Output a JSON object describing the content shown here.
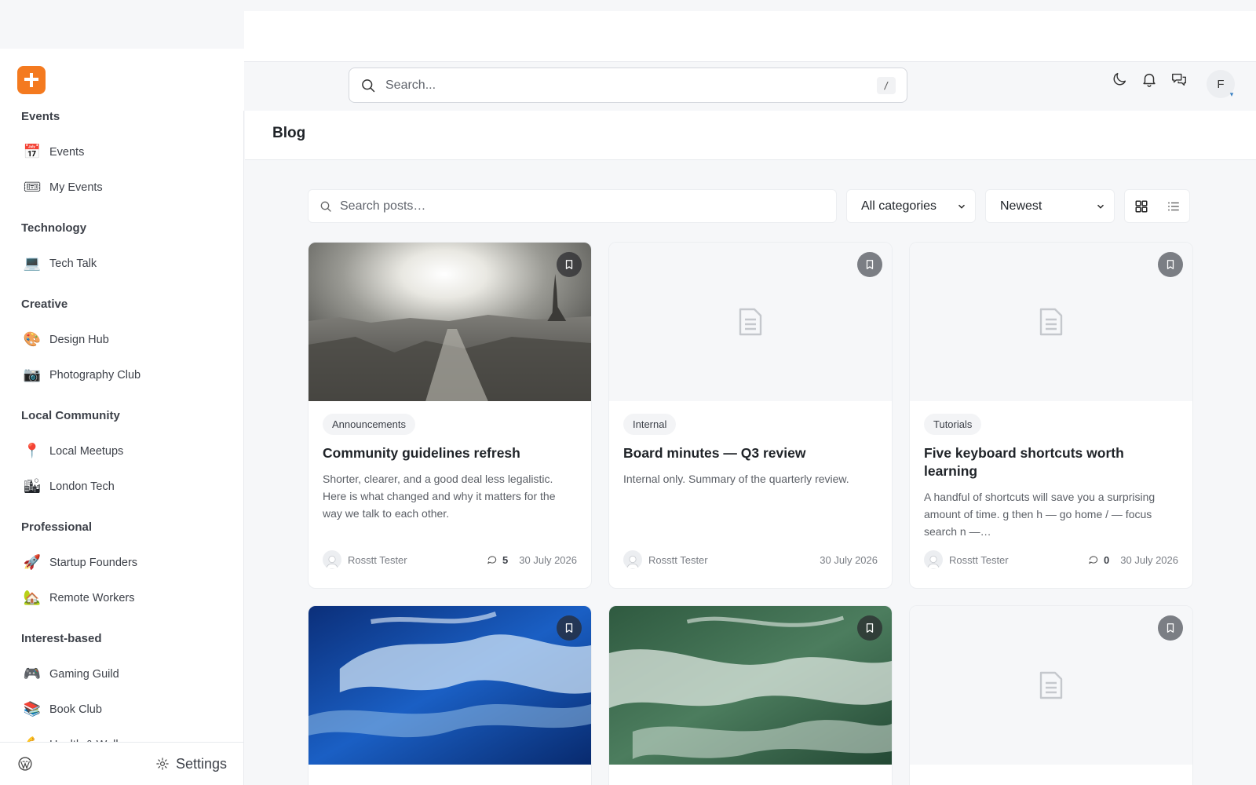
{
  "header": {
    "search_placeholder": "Search...",
    "search_shortcut": "/",
    "avatar_initial": "F"
  },
  "sidebar": {
    "sections": [
      {
        "title": "Events",
        "items": [
          {
            "label": "Events",
            "icon": "calendar-icon"
          },
          {
            "label": "My Events",
            "icon": "ticket-icon"
          }
        ]
      },
      {
        "title": "Technology",
        "items": [
          {
            "label": "Tech Talk",
            "icon": "laptop-icon"
          }
        ]
      },
      {
        "title": "Creative",
        "items": [
          {
            "label": "Design Hub",
            "icon": "palette-icon"
          },
          {
            "label": "Photography Club",
            "icon": "camera-icon"
          }
        ]
      },
      {
        "title": "Local Community",
        "items": [
          {
            "label": "Local Meetups",
            "icon": "pin-icon"
          },
          {
            "label": "London Tech",
            "icon": "city-icon"
          }
        ]
      },
      {
        "title": "Professional",
        "items": [
          {
            "label": "Startup Founders",
            "icon": "rocket-icon"
          },
          {
            "label": "Remote Workers",
            "icon": "house-icon"
          }
        ]
      },
      {
        "title": "Interest-based",
        "items": [
          {
            "label": "Gaming Guild",
            "icon": "gamepad-icon"
          },
          {
            "label": "Book Club",
            "icon": "books-icon"
          },
          {
            "label": "Health & Wellness",
            "icon": "muscle-icon"
          }
        ]
      }
    ],
    "settings_label": "Settings"
  },
  "page": {
    "title": "Blog",
    "search_posts_placeholder": "Search posts…",
    "category_select": "All categories",
    "sort_select": "Newest"
  },
  "posts": [
    {
      "tag": "Announcements",
      "title": "Community guidelines refresh",
      "excerpt": "Shorter, clearer, and a good deal less legalistic. Here is what changed and why it matters for the way we talk to each other.",
      "author": "Rosstt Tester",
      "comments": "5",
      "date": "30 July 2026",
      "image": "city-photo"
    },
    {
      "tag": "Internal",
      "title": "Board minutes — Q3 review",
      "excerpt": "Internal only. Summary of the quarterly review.",
      "author": "Rosstt Tester",
      "comments": "",
      "date": "30 July 2026",
      "image": "placeholder"
    },
    {
      "tag": "Tutorials",
      "title": "Five keyboard shortcuts worth learning",
      "excerpt": "A handful of shortcuts will save you a surprising amount of time. g then h — go home / — focus search n —…",
      "author": "Rosstt Tester",
      "comments": "0",
      "date": "30 July 2026",
      "image": "placeholder"
    },
    {
      "image": "blue-wave-photo"
    },
    {
      "image": "green-wave-photo"
    },
    {
      "image": "placeholder"
    }
  ],
  "colors": {
    "brand": "#f47a1f"
  }
}
